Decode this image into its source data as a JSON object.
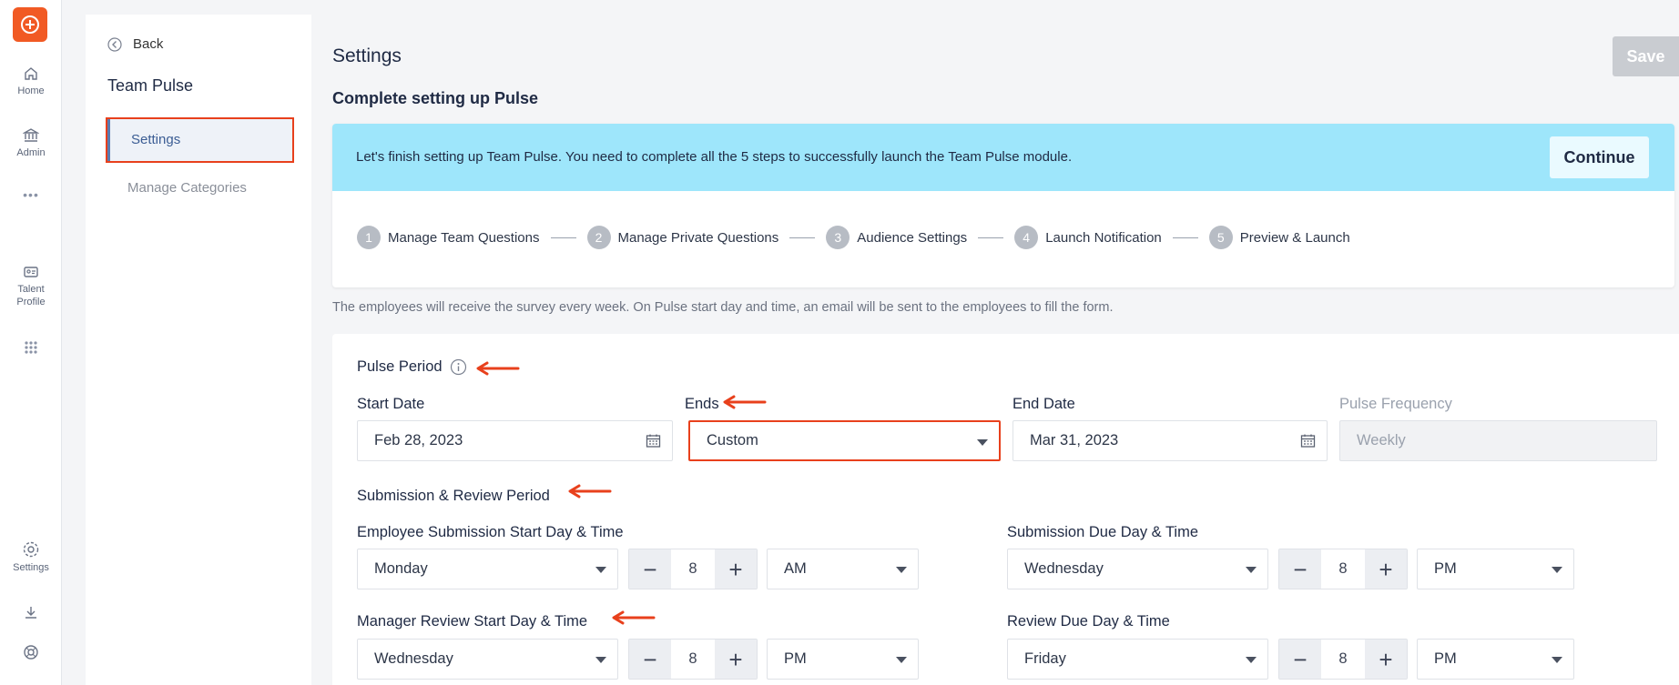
{
  "rail": {
    "items": [
      {
        "label": "Home",
        "icon": "home-icon"
      },
      {
        "label": "Admin",
        "icon": "bank-icon"
      },
      {
        "label": "Talent Profile",
        "icon": "id-card-icon"
      },
      {
        "label": "Settings",
        "icon": "gear-icon"
      }
    ],
    "more": "•••",
    "colors": {
      "brand": "#f15a24"
    }
  },
  "subnav": {
    "back_label": "Back",
    "title": "Team Pulse",
    "items": [
      {
        "label": "Settings",
        "active": true
      },
      {
        "label": "Manage Categories",
        "active": false
      }
    ]
  },
  "header": {
    "title": "Settings",
    "save_label": "Save"
  },
  "setup": {
    "title": "Complete setting up Pulse",
    "banner_text": "Let's finish setting up Team Pulse. You need to complete all the 5 steps to successfully launch the Team Pulse module.",
    "continue_label": "Continue",
    "steps": [
      {
        "num": "1",
        "label": "Manage Team Questions"
      },
      {
        "num": "2",
        "label": "Manage Private Questions"
      },
      {
        "num": "3",
        "label": "Audience Settings"
      },
      {
        "num": "4",
        "label": "Launch Notification"
      },
      {
        "num": "5",
        "label": "Preview & Launch"
      }
    ],
    "banner_color": "#9ee6fb"
  },
  "helper_text": "The employees will receive the survey every week. On Pulse start day and time, an email will be sent to the employees to fill the form.",
  "pulse_period": {
    "title": "Pulse Period",
    "start_date_label": "Start Date",
    "start_date": "Feb 28, 2023",
    "ends_label": "Ends",
    "ends_value": "Custom",
    "end_date_label": "End Date",
    "end_date": "Mar 31, 2023",
    "frequency_label": "Pulse Frequency",
    "frequency": "Weekly"
  },
  "submission": {
    "title": "Submission & Review Period",
    "emp_start_label": "Employee Submission Start Day & Time",
    "emp_start_day": "Monday",
    "emp_start_hour": "8",
    "emp_start_ampm": "AM",
    "due_label": "Submission Due Day & Time",
    "due_day": "Wednesday",
    "due_hour": "8",
    "due_ampm": "PM",
    "mgr_start_label": "Manager Review Start Day & Time",
    "mgr_start_day": "Wednesday",
    "mgr_start_hour": "8",
    "mgr_start_ampm": "PM",
    "review_due_label": "Review Due Day & Time",
    "review_due_day": "Friday",
    "review_due_hour": "8",
    "review_due_ampm": "PM"
  },
  "stepper": {
    "minus": "−",
    "plus": "+"
  },
  "annotation_color": "#e8401c"
}
